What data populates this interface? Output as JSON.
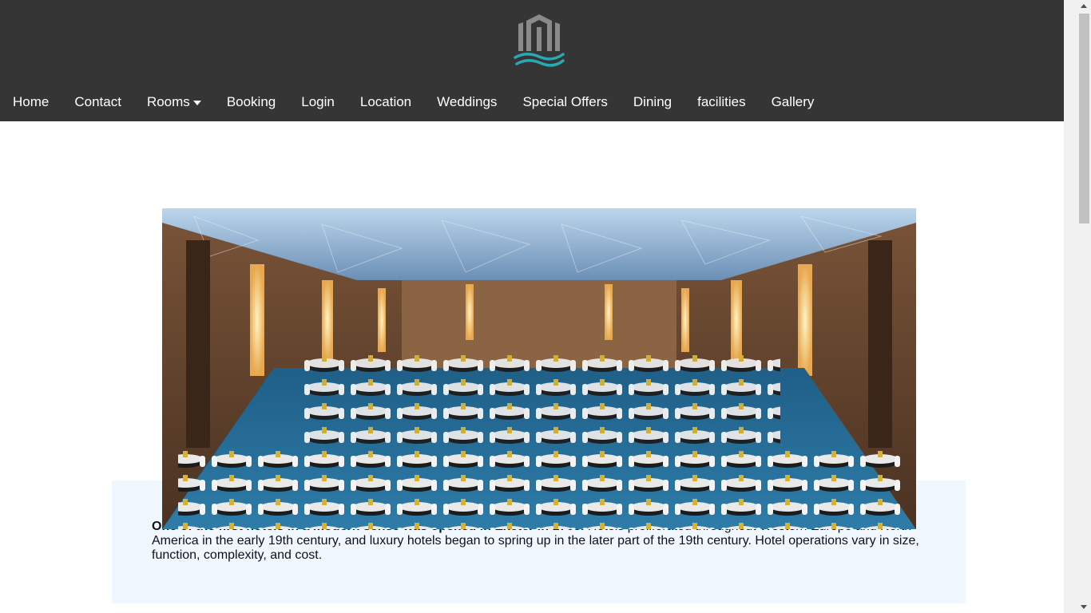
{
  "brand": {
    "logo_icon": "hotel-building-waves-logo",
    "accent_color": "#2aa9b5",
    "header_color": "#353535"
  },
  "nav": {
    "items": [
      {
        "label": "Home"
      },
      {
        "label": "Contact"
      },
      {
        "label": "Rooms",
        "has_dropdown": true
      },
      {
        "label": "Booking"
      },
      {
        "label": "Login"
      },
      {
        "label": "Location"
      },
      {
        "label": "Weddings"
      },
      {
        "label": "Special Offers"
      },
      {
        "label": "Dining"
      },
      {
        "label": "facilities"
      },
      {
        "label": "Gallery"
      }
    ]
  },
  "main": {
    "hero_image": "ballroom-banquet-photo",
    "info": {
      "lead": "One of the first hotels in a modern sense was opened in Exeter in 1768.",
      "body": " Hotels proliferated throughout Western Europe and North America in the early 19th century, and luxury hotels began to spring up in the later part of the 19th century. Hotel operations vary in size, function, complexity, and cost."
    }
  }
}
